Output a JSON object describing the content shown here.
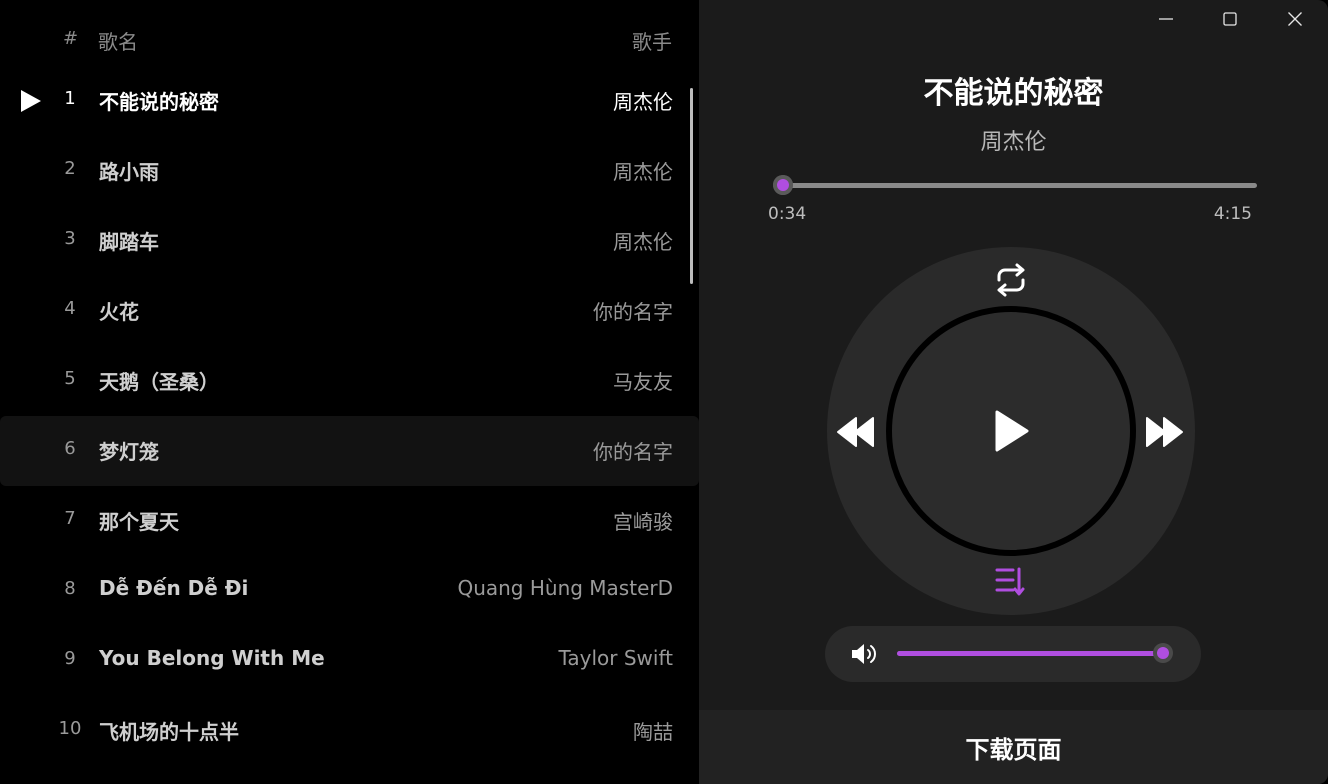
{
  "playlist": {
    "header": {
      "hash": "#",
      "title": "歌名",
      "artist": "歌手"
    },
    "tracks": [
      {
        "num": "1",
        "title": "不能说的秘密",
        "artist": "周杰伦"
      },
      {
        "num": "2",
        "title": "路小雨",
        "artist": "周杰伦"
      },
      {
        "num": "3",
        "title": "脚踏车",
        "artist": "周杰伦"
      },
      {
        "num": "4",
        "title": "火花",
        "artist": "你的名字"
      },
      {
        "num": "5",
        "title": "天鹅（圣桑）",
        "artist": "马友友"
      },
      {
        "num": "6",
        "title": "梦灯笼",
        "artist": "你的名字"
      },
      {
        "num": "7",
        "title": "那个夏天",
        "artist": "宫崎骏"
      },
      {
        "num": "8",
        "title": "Dễ Đến Dễ Đi",
        "artist": "Quang Hùng MasterD"
      },
      {
        "num": "9",
        "title": "You Belong With Me",
        "artist": "Taylor Swift"
      },
      {
        "num": "10",
        "title": "飞机场的十点半",
        "artist": "陶喆"
      }
    ],
    "playing_index": 0,
    "hovered_index": 5
  },
  "player": {
    "title": "不能说的秘密",
    "artist": "周杰伦",
    "time_current": "0:34",
    "time_total": "4:15",
    "progress_fraction": 0.005,
    "volume_fraction": 1.0,
    "download_label": "下载页面",
    "accent_color": "#b04ee0",
    "icons": {
      "repeat": "repeat-icon",
      "rewind": "rewind-icon",
      "play": "play-icon",
      "forward": "fast-forward-icon",
      "queue": "queue-list-icon",
      "volume": "volume-icon"
    }
  },
  "window_controls": [
    "minimize-icon",
    "maximize-icon",
    "close-icon"
  ]
}
